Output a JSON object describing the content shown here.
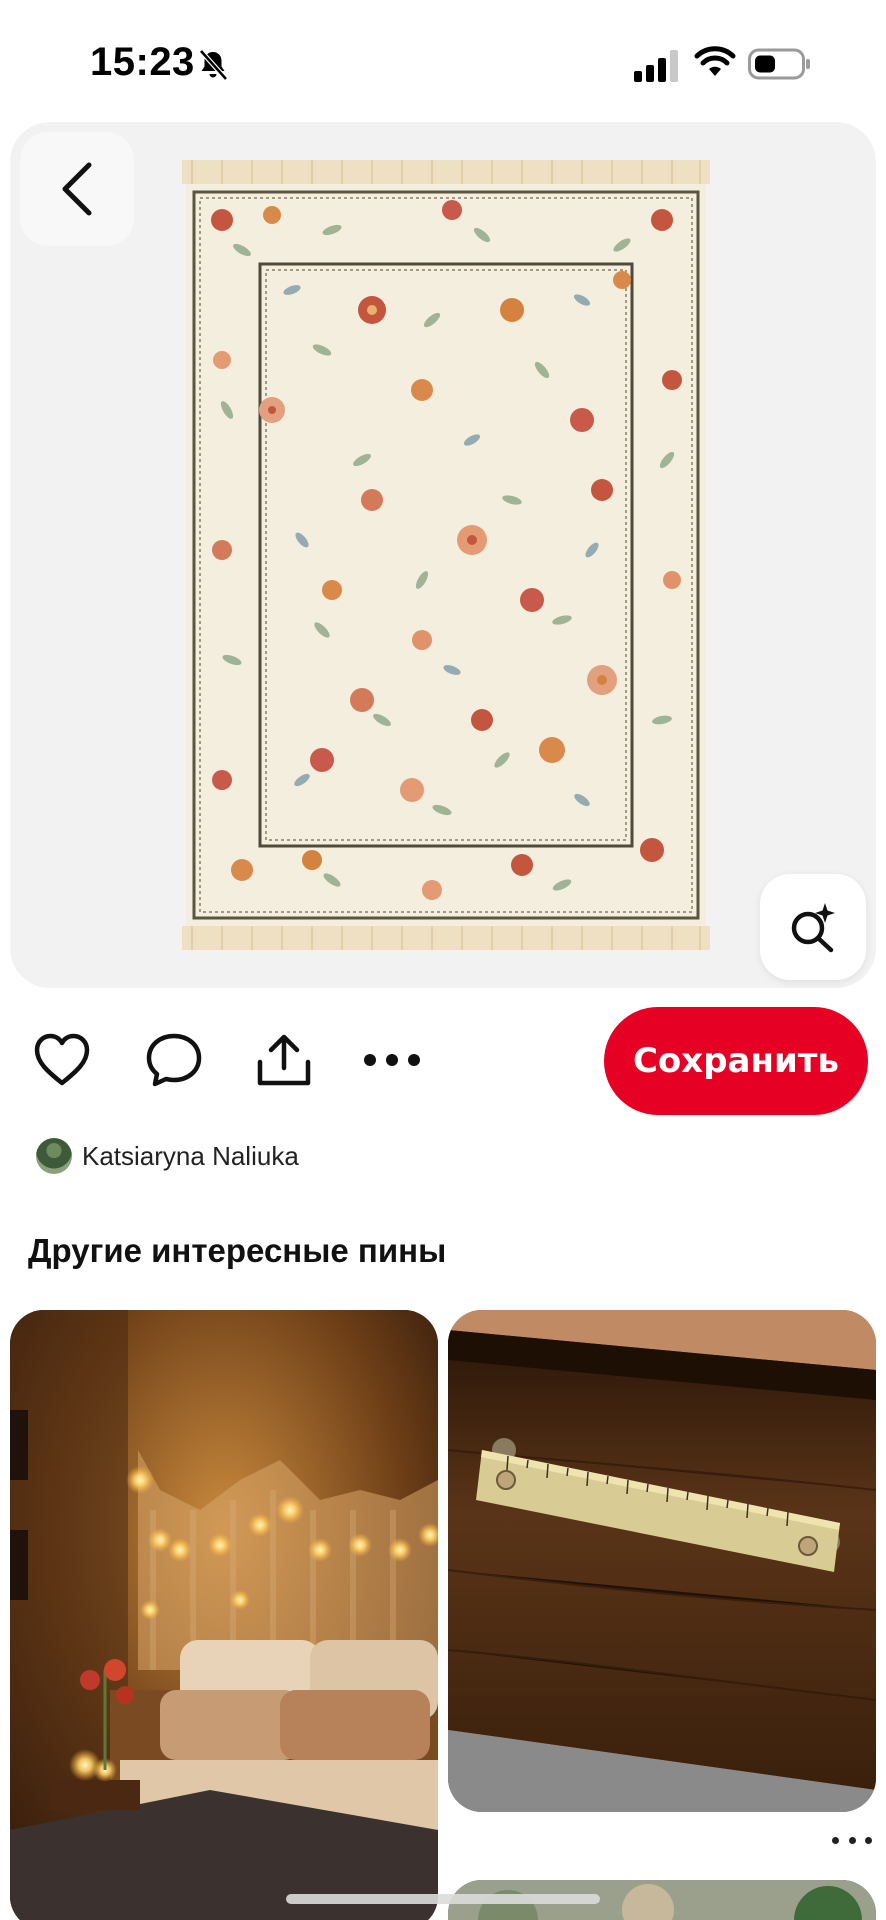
{
  "status_bar": {
    "time": "15:23",
    "icons": [
      "bell-off-icon",
      "cellular-signal-icon",
      "wifi-icon",
      "battery-icon"
    ]
  },
  "hero": {
    "image": "floral-rug-image",
    "back_icon": "chevron-left-icon",
    "visual_search_icon": "visual-search-sparkle-icon"
  },
  "actions": {
    "icons": [
      "heart-icon",
      "comment-icon",
      "share-icon",
      "more-icon"
    ],
    "save_label": "Сохранить"
  },
  "author": {
    "name": "Katsiaryna Naliuka"
  },
  "more_pins": {
    "title": "Другие интересные пины",
    "pins": [
      {
        "image": "bedroom-string-lights-image"
      },
      {
        "image": "ruler-drawer-handle-image"
      },
      {
        "image": "partial-pin-image"
      }
    ],
    "more_icon": "more-horizontal-icon"
  },
  "colors": {
    "accent": "#e60023",
    "hero_bg": "#f2f2f2"
  }
}
